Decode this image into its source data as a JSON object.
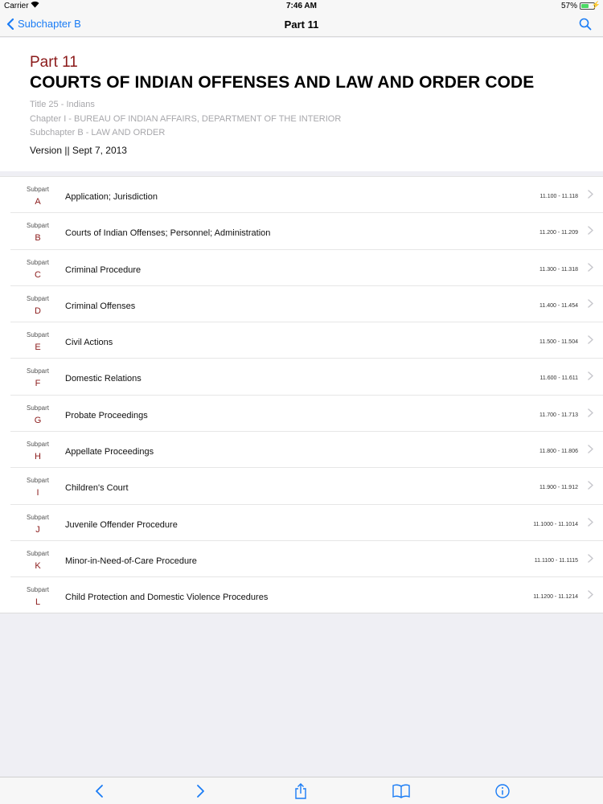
{
  "status_bar": {
    "carrier": "Carrier",
    "time": "7:46 AM",
    "battery_pct": "57%",
    "battery_level": 0.57
  },
  "nav": {
    "back_label": "Subchapter B",
    "title": "Part 11"
  },
  "header": {
    "part": "Part 11",
    "title": "COURTS OF INDIAN OFFENSES AND LAW AND ORDER CODE",
    "title_line": "Title 25 - Indians",
    "chapter_line": "Chapter I - BUREAU OF INDIAN AFFAIRS, DEPARTMENT OF THE INTERIOR",
    "subchapter_line": "Subchapter B - LAW AND ORDER",
    "version": "Version || Sept 7, 2013"
  },
  "subparts": [
    {
      "label": "Subpart",
      "letter": "A",
      "title": "Application; Jurisdiction",
      "range": "11.100 - 11.118"
    },
    {
      "label": "Subpart",
      "letter": "B",
      "title": "Courts of Indian Offenses; Personnel; Administration",
      "range": "11.200 - 11.209"
    },
    {
      "label": "Subpart",
      "letter": "C",
      "title": "Criminal Procedure",
      "range": "11.300 - 11.318"
    },
    {
      "label": "Subpart",
      "letter": "D",
      "title": "Criminal Offenses",
      "range": "11.400 - 11.454"
    },
    {
      "label": "Subpart",
      "letter": "E",
      "title": "Civil Actions",
      "range": "11.500 - 11.504"
    },
    {
      "label": "Subpart",
      "letter": "F",
      "title": "Domestic Relations",
      "range": "11.600 - 11.611"
    },
    {
      "label": "Subpart",
      "letter": "G",
      "title": "Probate Proceedings",
      "range": "11.700 - 11.713"
    },
    {
      "label": "Subpart",
      "letter": "H",
      "title": "Appellate Proceedings",
      "range": "11.800 - 11.806"
    },
    {
      "label": "Subpart",
      "letter": "I",
      "title": "Children's Court",
      "range": "11.900 - 11.912"
    },
    {
      "label": "Subpart",
      "letter": "J",
      "title": "Juvenile Offender Procedure",
      "range": "11.1000 - 11.1014"
    },
    {
      "label": "Subpart",
      "letter": "K",
      "title": "Minor-in-Need-of-Care Procedure",
      "range": "11.1100 - 11.1115"
    },
    {
      "label": "Subpart",
      "letter": "L",
      "title": "Child Protection and Domestic Violence Procedures",
      "range": "11.1200 - 11.1214"
    }
  ],
  "toolbar": {
    "icons": [
      "back-arrow-icon",
      "forward-arrow-icon",
      "share-icon",
      "book-icon",
      "info-icon"
    ]
  },
  "colors": {
    "accent": "#1a7cf5",
    "subpart_letter": "#8b1a1a",
    "background": "#efeff4"
  }
}
